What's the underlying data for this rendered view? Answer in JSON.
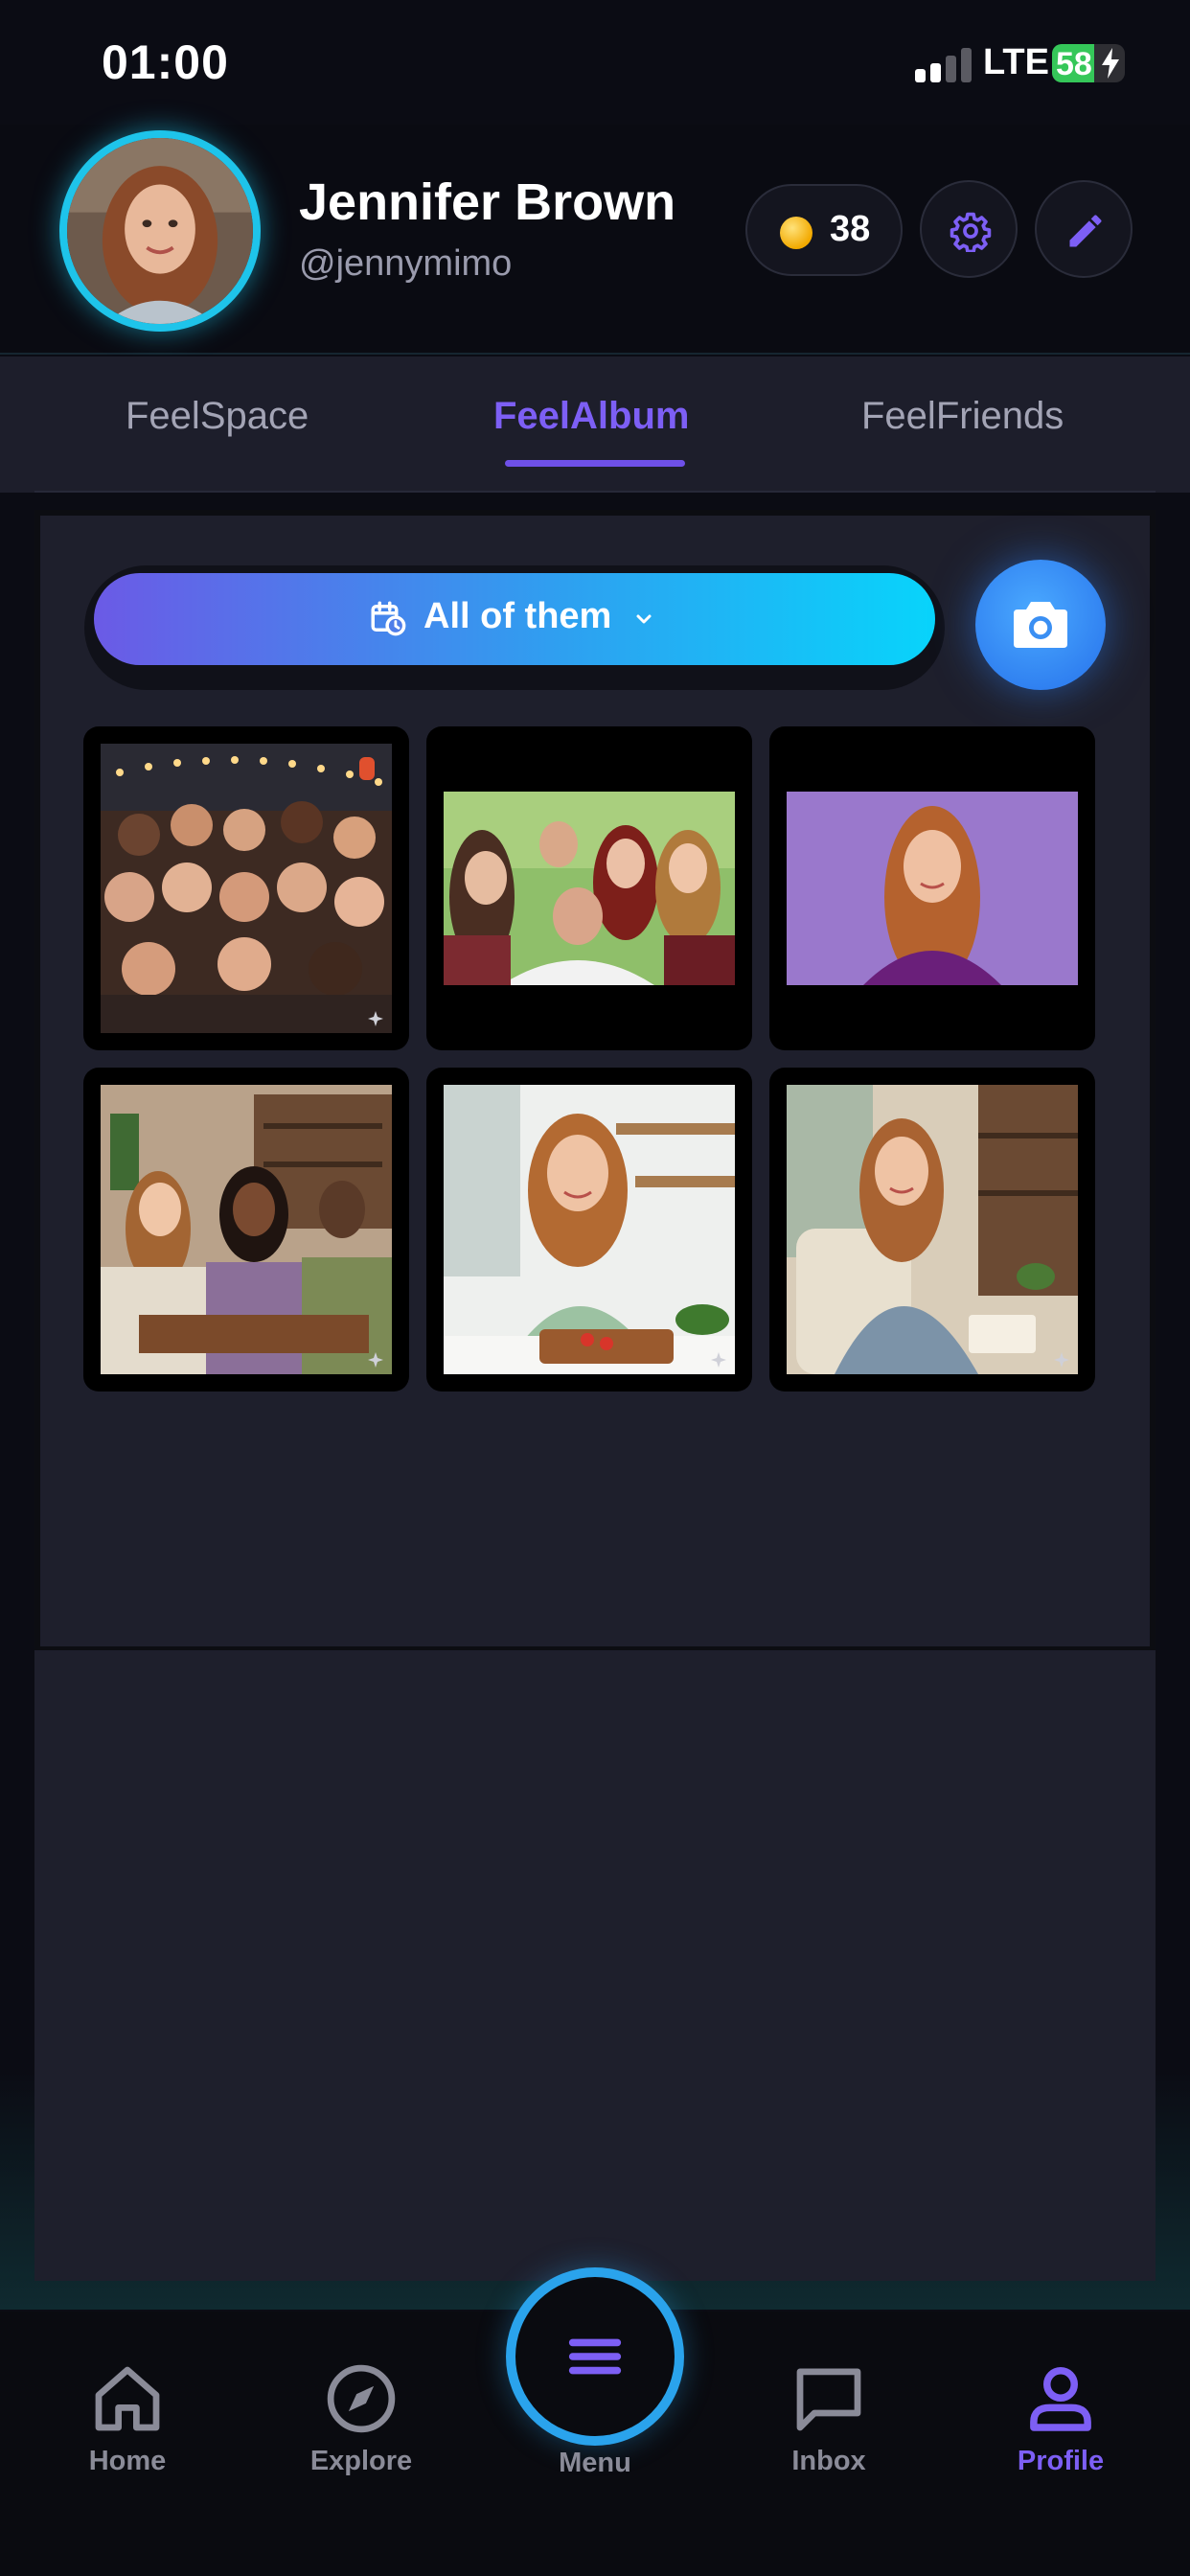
{
  "status_bar": {
    "time": "01:00",
    "network": "LTE",
    "battery": "58",
    "battery_level": 0.58
  },
  "profile": {
    "name": "Jennifer Brown",
    "handle": "@jennymimo",
    "coins": "38",
    "avatar_ring_color": "#1ec4ea"
  },
  "header_actions": {
    "settings_icon": "gear-icon",
    "edit_icon": "pencil-icon"
  },
  "tabs": [
    {
      "label": "FeelSpace",
      "active": false
    },
    {
      "label": "FeelAlbum",
      "active": true
    },
    {
      "label": "FeelFriends",
      "active": false
    }
  ],
  "album": {
    "filter_label": "All of them",
    "filter_icon": "calendar-clock-icon",
    "camera_icon": "camera-icon",
    "photos": [
      {
        "scene": "crowd-night-lights"
      },
      {
        "scene": "friends-selfie-group"
      },
      {
        "scene": "portrait-purple-backdrop"
      },
      {
        "scene": "friends-cafe-table"
      },
      {
        "scene": "cooking-kitchen"
      },
      {
        "scene": "reading-armchair"
      }
    ]
  },
  "bottom_nav": {
    "items": [
      {
        "label": "Home",
        "icon": "home-icon",
        "active": false
      },
      {
        "label": "Explore",
        "icon": "compass-icon",
        "active": false
      },
      {
        "label": "Menu",
        "icon": "menu-icon",
        "active": false
      },
      {
        "label": "Inbox",
        "icon": "chat-bubble-icon",
        "active": false
      },
      {
        "label": "Profile",
        "icon": "user-icon",
        "active": true
      }
    ]
  },
  "colors": {
    "accent": "#7d5ff5",
    "gradient_start": "#6b5ae6",
    "gradient_end": "#08d4fb",
    "background": "#0b0c14",
    "panel": "#1e1f2c"
  }
}
